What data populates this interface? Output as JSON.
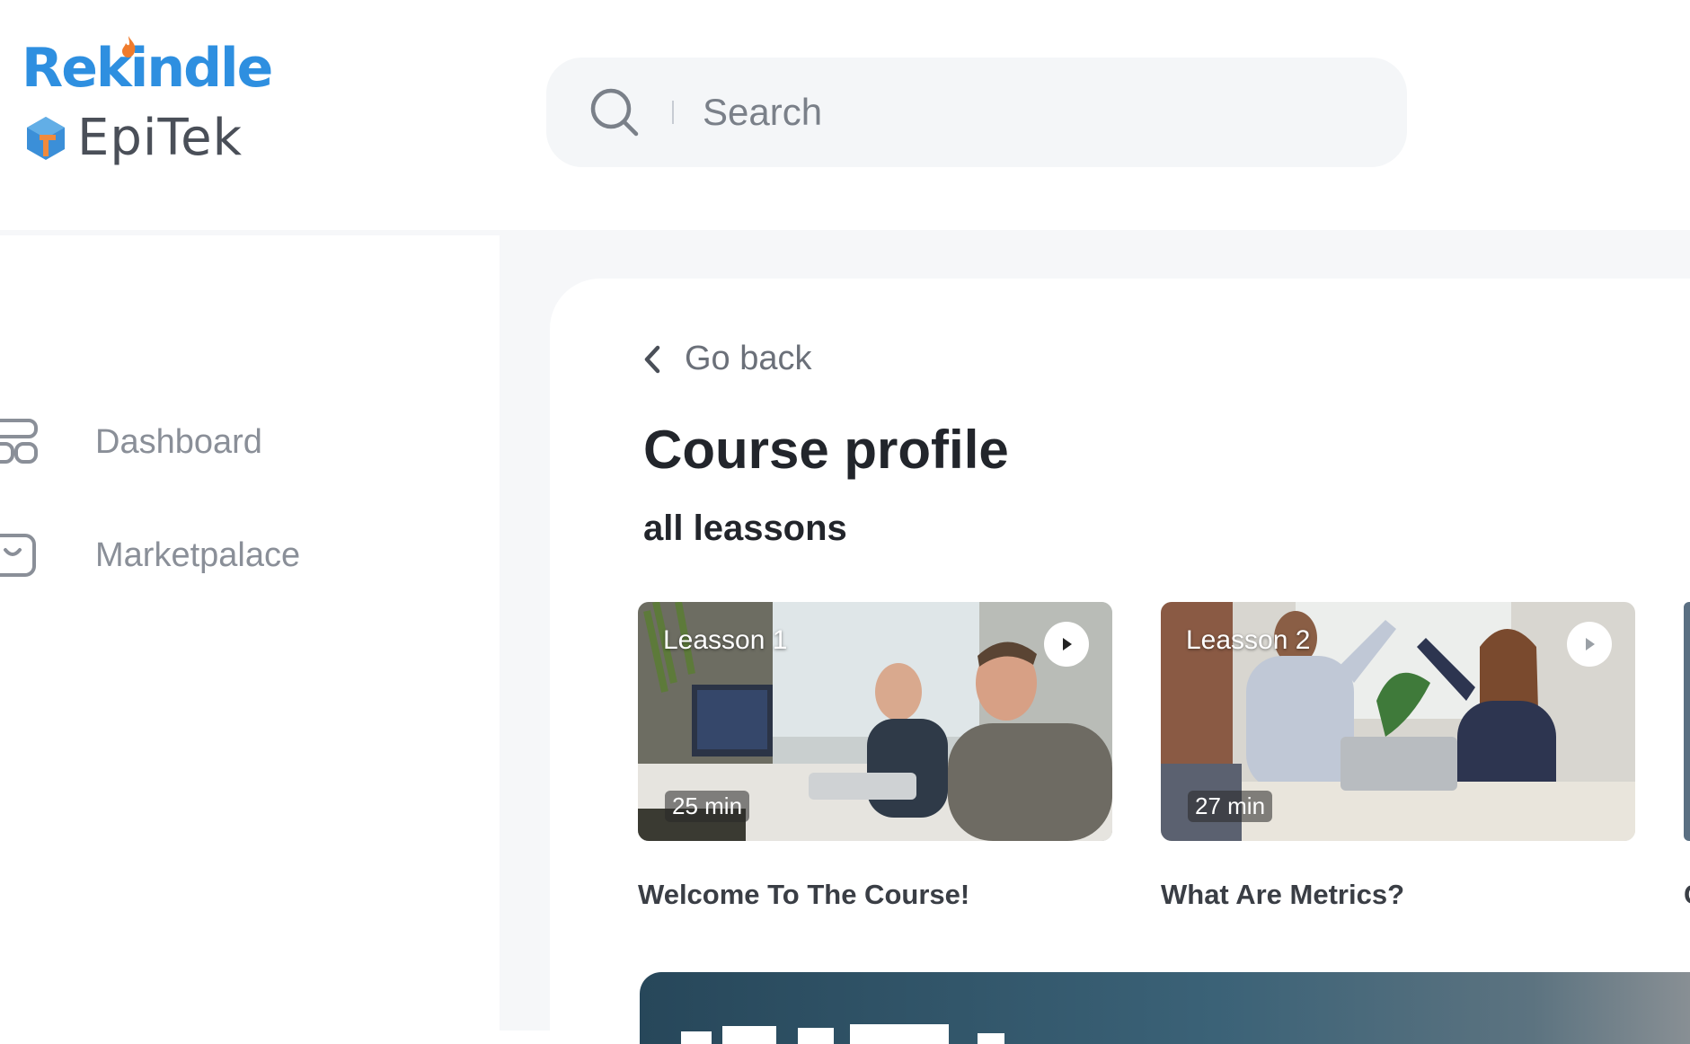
{
  "brand": {
    "name_top": "Rekindle",
    "name_bottom": "EpiTek",
    "primary_color": "#2e8fe0",
    "flame_color": "#f07b2c"
  },
  "search": {
    "placeholder": "Search",
    "icon": "search-icon"
  },
  "sidebar": {
    "items": [
      {
        "label": "Dashboard",
        "icon": "dashboard-icon"
      },
      {
        "label": "Marketpalace",
        "icon": "marketplace-icon"
      }
    ]
  },
  "main": {
    "back_label": "Go back",
    "title": "Course profile",
    "section_title": "all leassons",
    "lessons": [
      {
        "tag": "Leasson 1",
        "duration": "25 min",
        "title": "Welcome To The Course!"
      },
      {
        "tag": "Leasson 2",
        "duration": "27 min",
        "title": "What Are Metrics?"
      }
    ],
    "partial_lesson_title_initial": "C"
  }
}
